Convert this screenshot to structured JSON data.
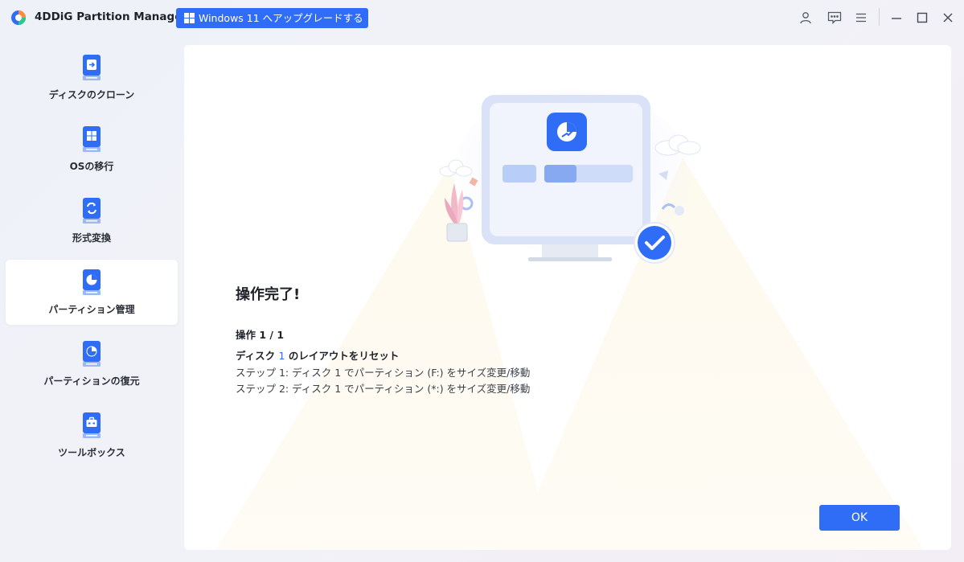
{
  "app": {
    "title": "4DDiG Partition Manager",
    "upgrade_label": "Windows 11 へアップグレードする",
    "accent_color": "#2f6df6"
  },
  "titlebar_icons": [
    "user-icon",
    "feedback-icon",
    "menu-icon",
    "minimize-icon",
    "maximize-icon",
    "close-icon"
  ],
  "sidebar": {
    "items": [
      {
        "label": "ディスクのクローン",
        "icon": "disk-clone-icon",
        "active": false
      },
      {
        "label": "OSの移行",
        "icon": "os-migration-icon",
        "active": false
      },
      {
        "label": "形式変換",
        "icon": "format-convert-icon",
        "active": false
      },
      {
        "label": "パーティション管理",
        "icon": "partition-management-icon",
        "active": true
      },
      {
        "label": "パーティションの復元",
        "icon": "partition-recovery-icon",
        "active": false
      },
      {
        "label": "ツールボックス",
        "icon": "toolbox-icon",
        "active": false
      }
    ]
  },
  "main": {
    "title": "操作完了!",
    "operation_count": "操作 1 / 1",
    "operation": {
      "prefix": "ディスク",
      "disk_number": "1",
      "suffix": "のレイアウトをリセット"
    },
    "steps": [
      "ステップ 1: ディスク 1 でパーティション (F:) をサイズ変更/移動",
      "ステップ 2: ディスク 1 でパーティション (*:) をサイズ変更/移動"
    ],
    "ok_label": "OK"
  }
}
